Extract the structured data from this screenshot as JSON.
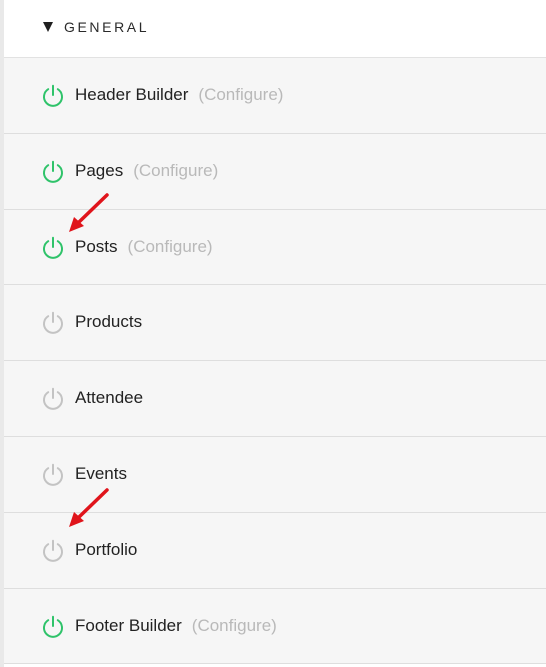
{
  "section": {
    "title": "GENERAL"
  },
  "modules": [
    {
      "label": "Header Builder",
      "enabled": true,
      "configure": "(Configure)"
    },
    {
      "label": "Pages",
      "enabled": true,
      "configure": "(Configure)"
    },
    {
      "label": "Posts",
      "enabled": true,
      "configure": "(Configure)"
    },
    {
      "label": "Products",
      "enabled": false,
      "configure": ""
    },
    {
      "label": "Attendee",
      "enabled": false,
      "configure": ""
    },
    {
      "label": "Events",
      "enabled": false,
      "configure": ""
    },
    {
      "label": "Portfolio",
      "enabled": false,
      "configure": ""
    },
    {
      "label": "Footer Builder",
      "enabled": true,
      "configure": "(Configure)"
    }
  ],
  "colors": {
    "enabled": "#2fc36a",
    "disabled": "#c3c3c3",
    "annotation_arrow": "#e0141b"
  },
  "icons": {
    "toggle": "power-icon",
    "collapse": "triangle-down-icon"
  }
}
